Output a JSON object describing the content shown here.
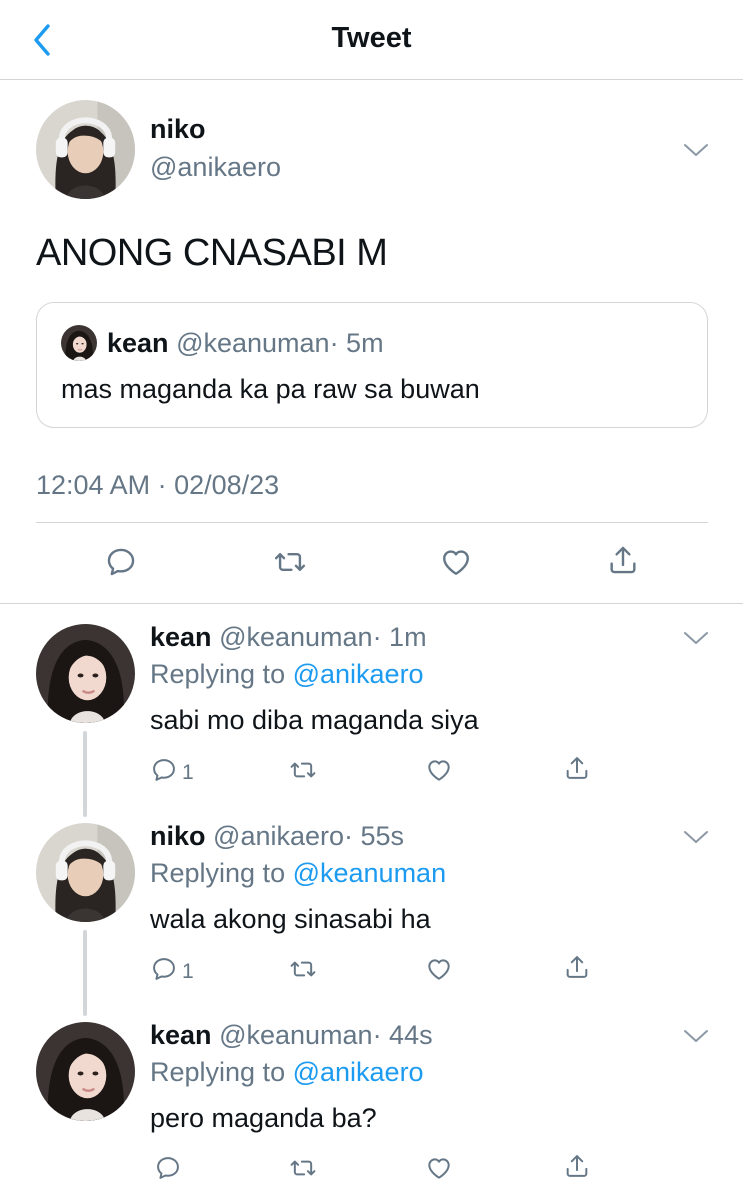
{
  "header": {
    "title": "Tweet"
  },
  "main_tweet": {
    "name": "niko",
    "handle": "@anikaero",
    "text": "ANONG CNASABI M",
    "quote": {
      "name": "kean",
      "handle": "@keanuman",
      "time": "· 5m",
      "text": "mas maganda ka pa raw sa buwan"
    },
    "timestamp": "12:04 AM · 02/08/23"
  },
  "replies": [
    {
      "name": "kean",
      "handle": "@keanuman",
      "time": "· 1m",
      "replying_prefix": "Replying to ",
      "replying_to": "@anikaero",
      "text": "sabi mo diba maganda siya",
      "reply_count": "1"
    },
    {
      "name": "niko",
      "handle": "@anikaero",
      "time": "· 55s",
      "replying_prefix": "Replying to ",
      "replying_to": "@keanuman",
      "text": "wala akong sinasabi ha",
      "reply_count": "1"
    },
    {
      "name": "kean",
      "handle": "@keanuman",
      "time": "· 44s",
      "replying_prefix": "Replying to ",
      "replying_to": "@anikaero",
      "text": "pero maganda ba?",
      "reply_count": ""
    }
  ],
  "icons": {
    "back": "chevron-left-icon",
    "more": "chevron-down-icon",
    "reply": "speech-bubble-icon",
    "retweet": "retweet-arrows-icon",
    "like": "heart-icon",
    "share": "share-arrow-icon"
  },
  "colors": {
    "accent": "#1d9bf0",
    "secondary_text": "#657786",
    "divider": "#d3d6d9",
    "icon": "#657786"
  }
}
